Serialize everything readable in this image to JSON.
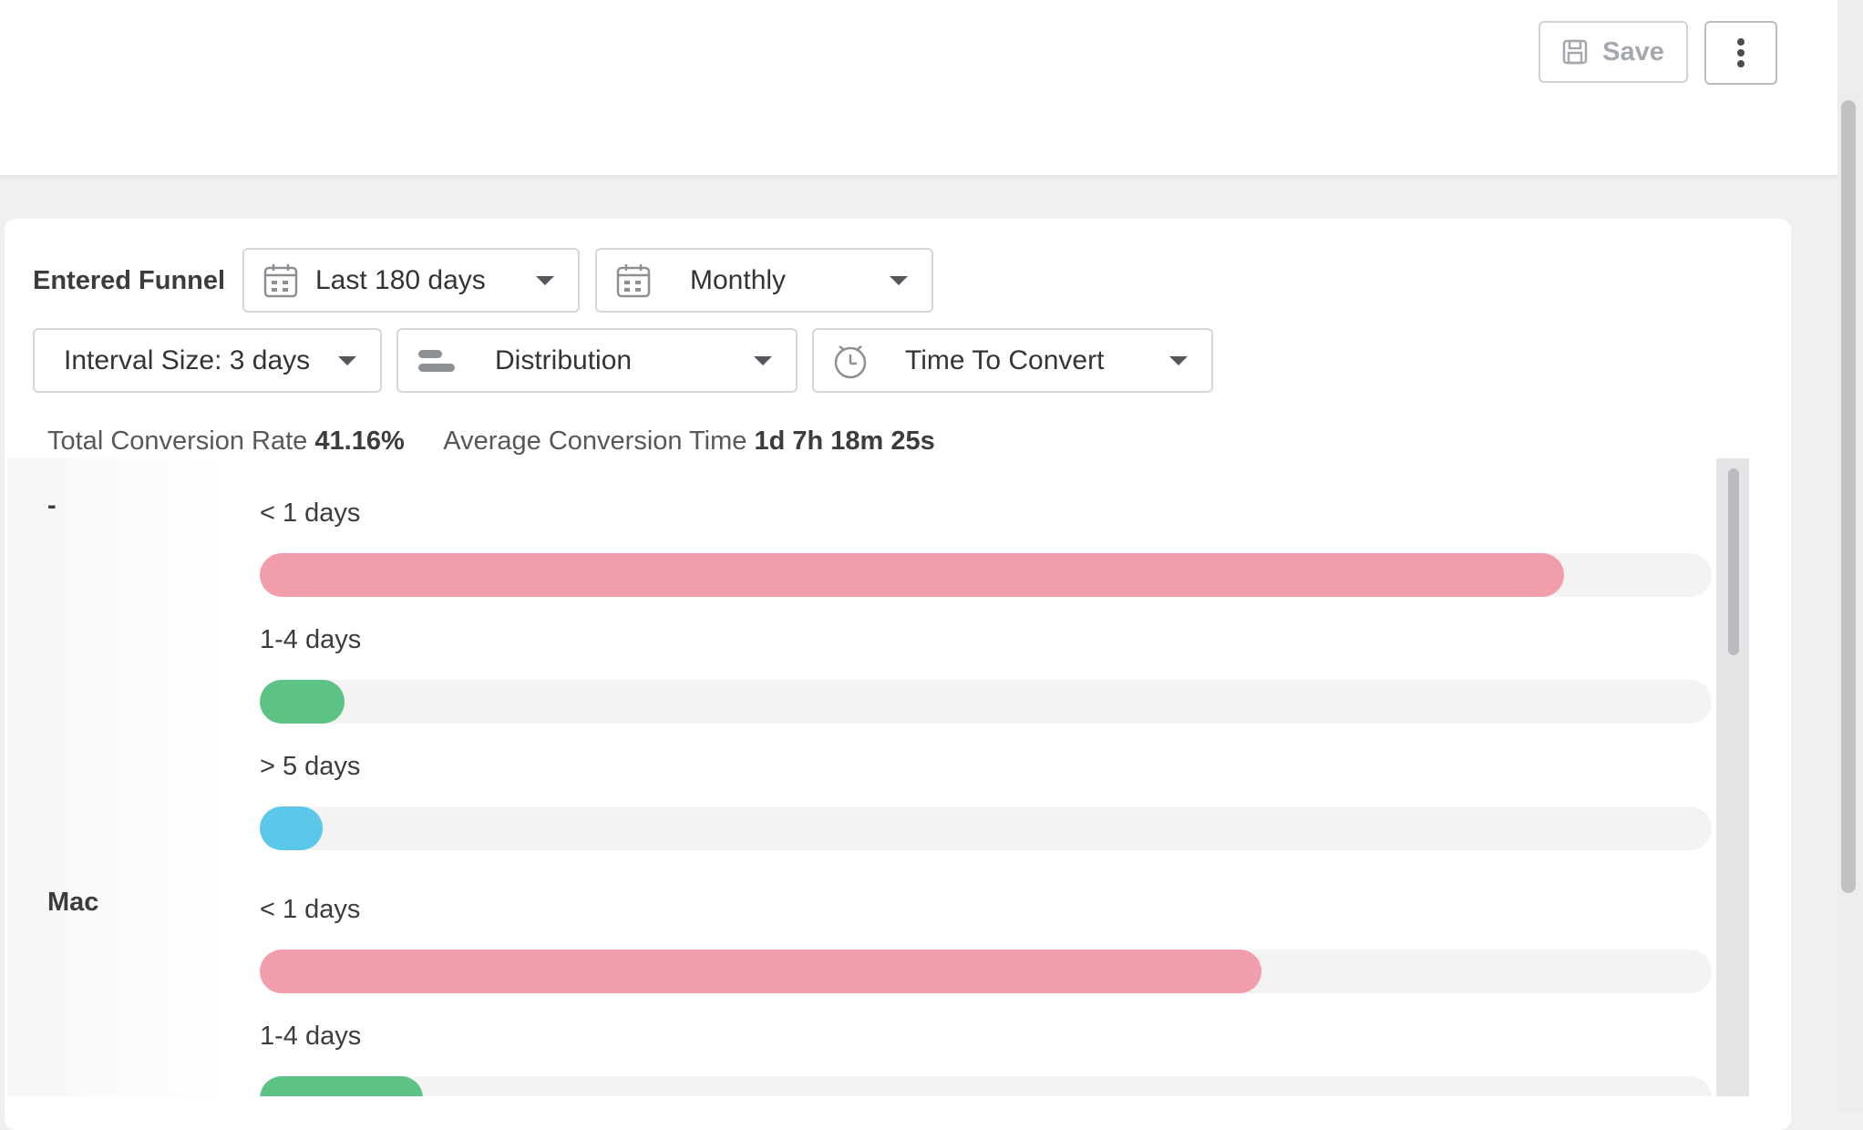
{
  "toolbar": {
    "save_label": "Save",
    "save_icon": "floppy-disk-icon",
    "more_icon": "vertical-dots-icon"
  },
  "filters": {
    "funnel_label": "Entered Funnel",
    "date_range": "Last 180 days",
    "period": "Monthly",
    "interval": "Interval Size: 3 days",
    "view": "Distribution",
    "metric": "Time To Convert"
  },
  "stats": {
    "conversion_rate_label": "Total Conversion Rate",
    "conversion_rate_value": "41.16%",
    "avg_time_label": "Average Conversion Time",
    "avg_time_value": "1d 7h 18m 25s"
  },
  "colors": {
    "pink": "#f29dab",
    "green": "#5cc384",
    "blue": "#5bc8ea"
  },
  "groups": [
    {
      "name": "-",
      "rows": [
        {
          "label": "< 1 days",
          "pct_text": "89.82%",
          "value": 89.82,
          "color": "#f29dab"
        },
        {
          "label": "1-4 days",
          "pct_text": "5.86%",
          "value": 5.86,
          "color": "#5cc384"
        },
        {
          "label": "> 5 days",
          "pct_text": "4.32%",
          "value": 4.32,
          "color": "#5bc8ea"
        }
      ]
    },
    {
      "name": "Mac",
      "rows": [
        {
          "label": "< 1 days",
          "pct_text": "69%",
          "value": 69,
          "color": "#f29dab"
        },
        {
          "label": "1-4 days",
          "pct_text": "11.21%",
          "value": 11.21,
          "color": "#5cc384"
        }
      ]
    }
  ]
}
